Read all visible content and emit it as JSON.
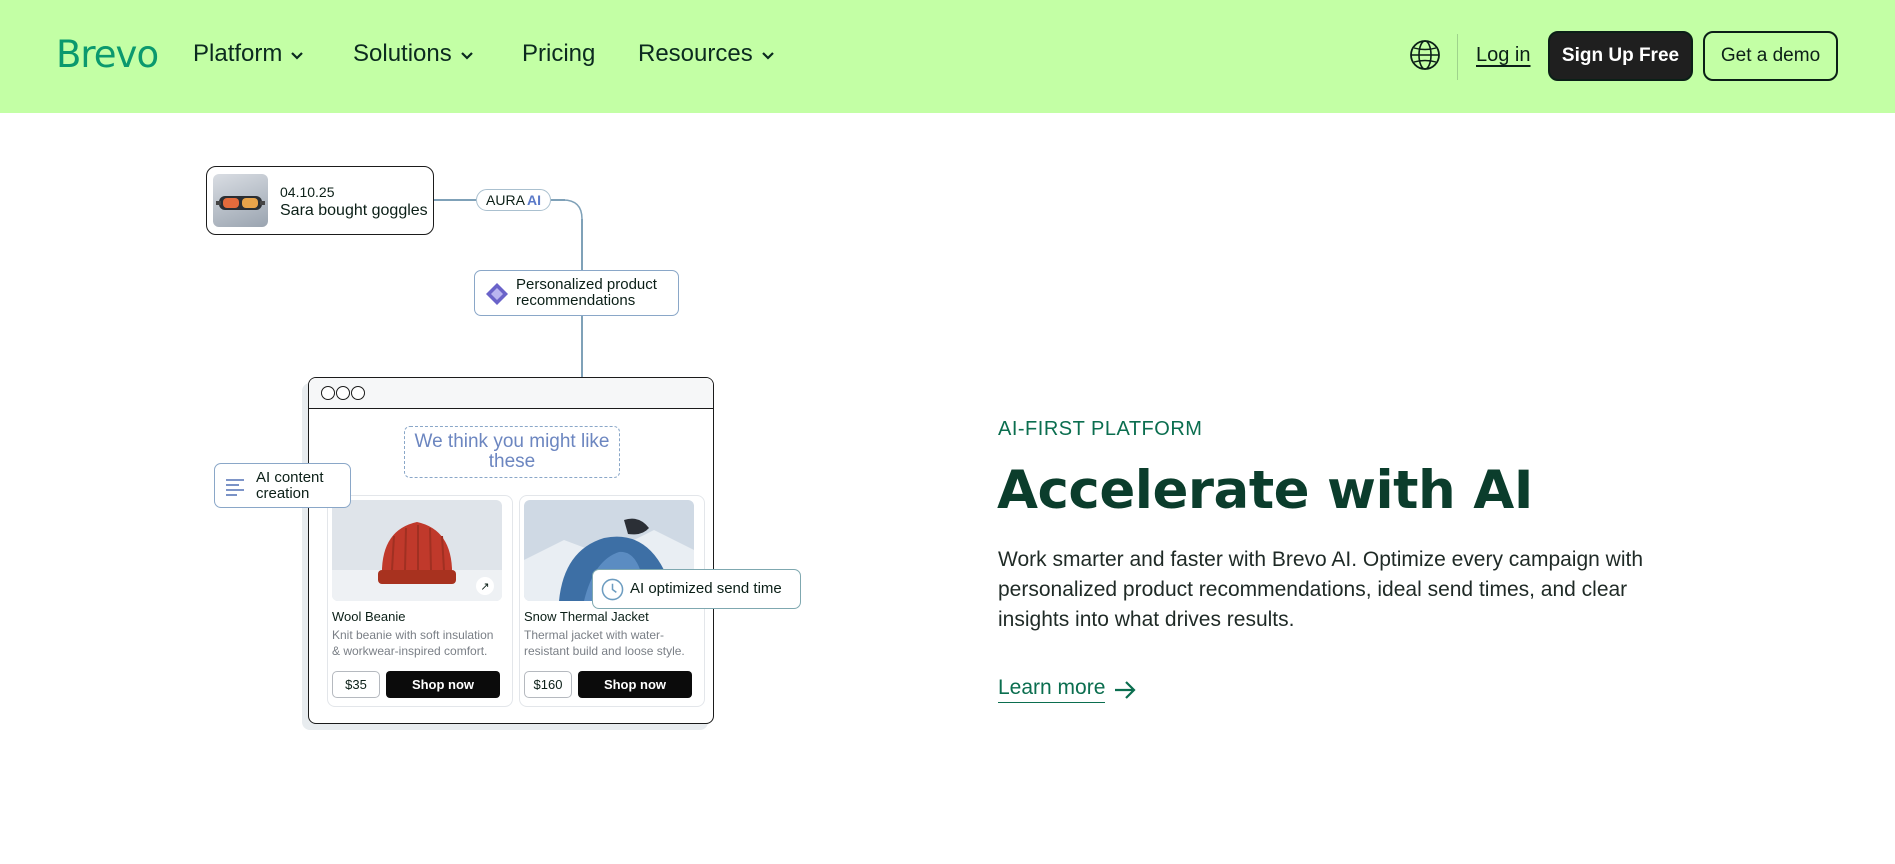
{
  "nav": {
    "logo": "Brevo",
    "items": [
      {
        "label": "Platform",
        "has_dropdown": true
      },
      {
        "label": "Solutions",
        "has_dropdown": true
      },
      {
        "label": "Pricing",
        "has_dropdown": false
      },
      {
        "label": "Resources",
        "has_dropdown": true
      }
    ],
    "globe_icon": "globe-icon",
    "login": "Log in",
    "signup": "Sign Up Free",
    "demo": "Get a demo",
    "bg_color": "#c3ffa5",
    "logo_color": "#0b996e"
  },
  "illustration": {
    "event": {
      "date": "04.10.25",
      "text": "Sara bought goggles"
    },
    "aura": {
      "label": "AURA",
      "ai": "AI"
    },
    "recommendations": "Personalized product recommendations",
    "headline": "We think you might like these",
    "content_chip": "AI content creation",
    "send_chip": "AI optimized send time",
    "products": [
      {
        "name": "Wool Beanie",
        "desc": "Knit beanie with soft insulation & workwear-inspired comfort.",
        "price": "$35",
        "cta": "Shop now"
      },
      {
        "name": "Snow Thermal Jacket",
        "desc": "Thermal jacket with water-resistant build and loose style.",
        "price": "$160",
        "cta": "Shop now"
      }
    ]
  },
  "section": {
    "eyebrow": "AI-FIRST PLATFORM",
    "title": "Accelerate with AI",
    "body": "Work smarter and faster with Brevo AI. Optimize every campaign with personalized product recommendations, ideal send times, and clear insights into what drives results.",
    "cta": "Learn more",
    "accent_color": "#0b6e4f",
    "title_color": "#0b3d2c"
  }
}
